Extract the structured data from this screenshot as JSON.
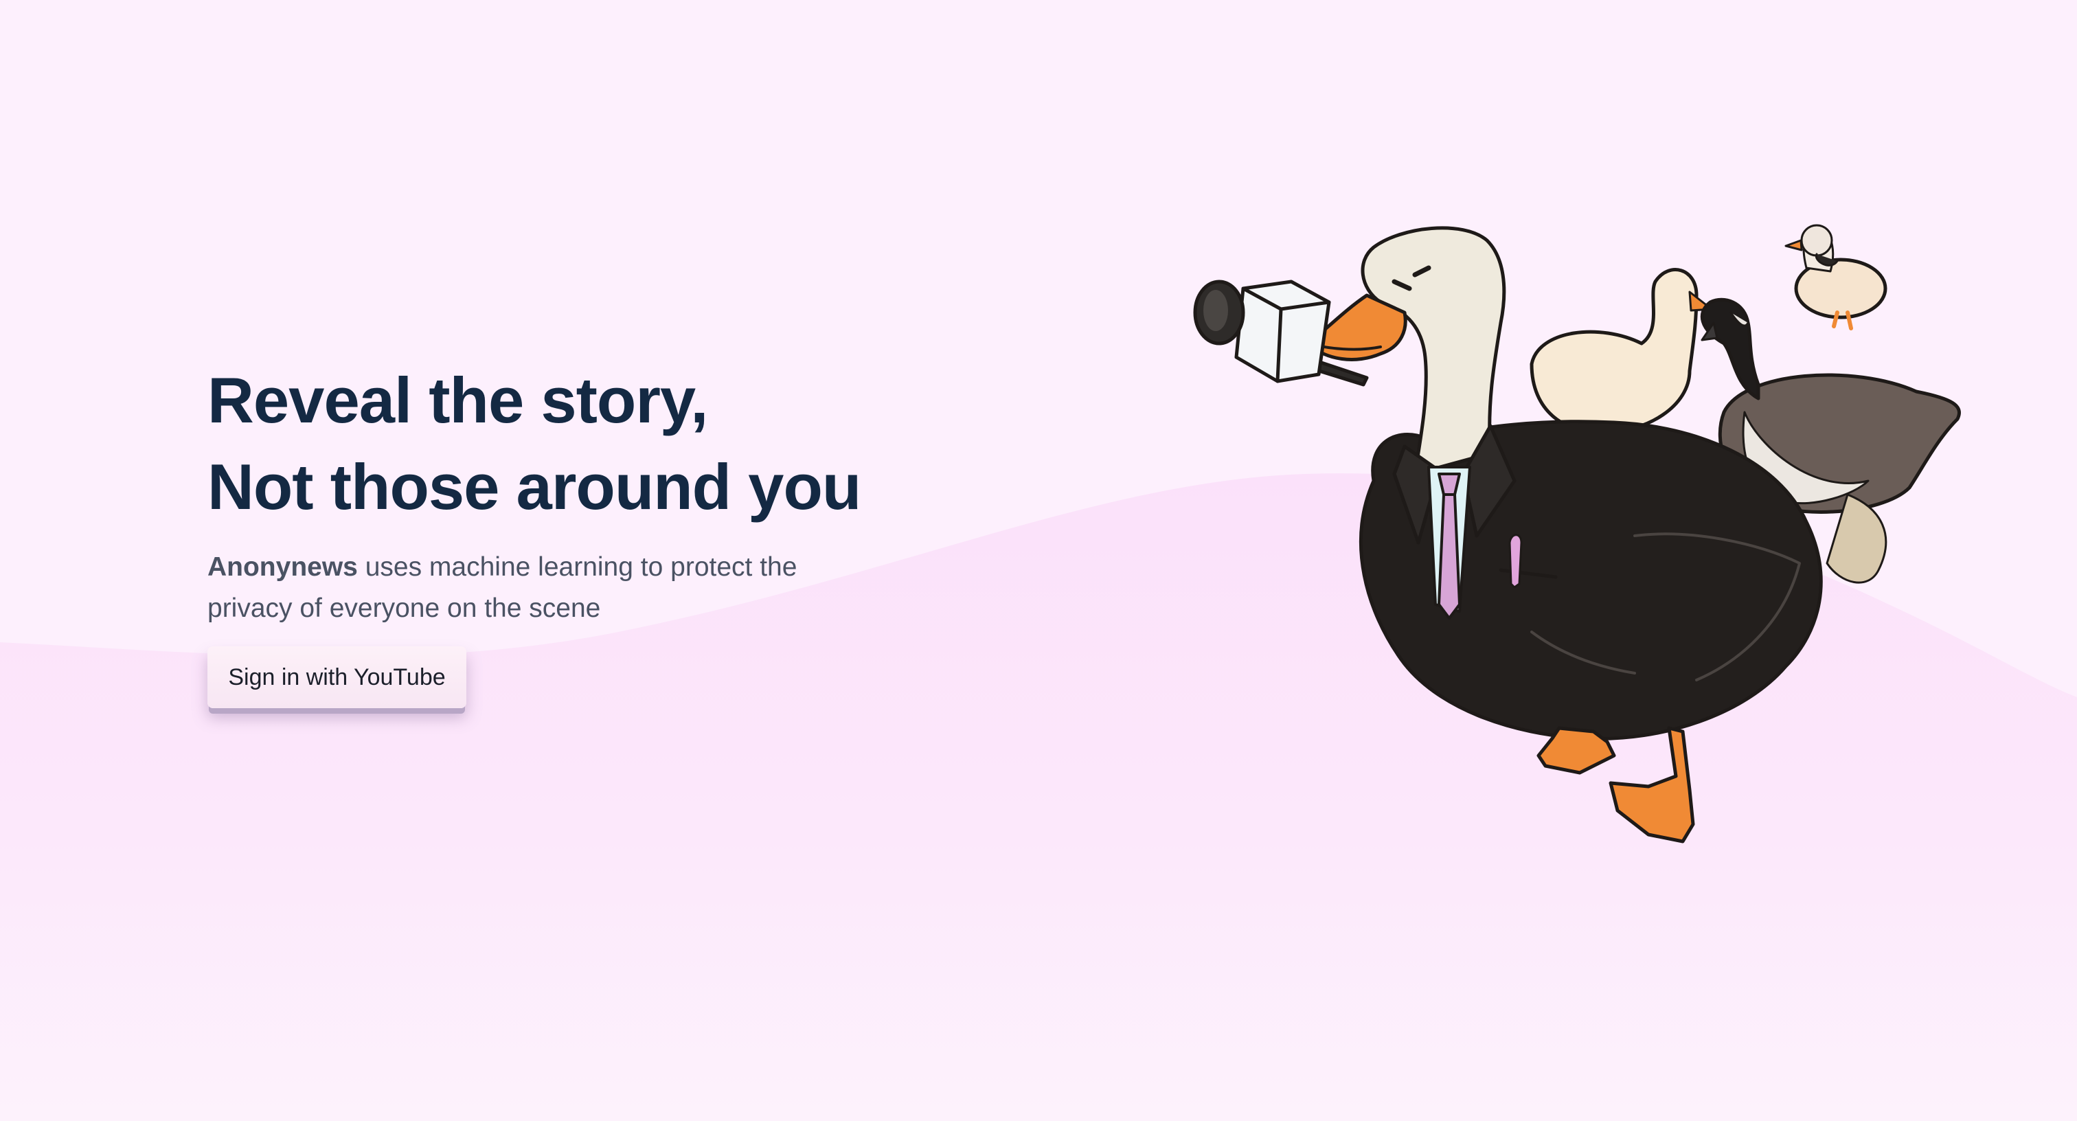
{
  "hero": {
    "headline_line1": "Reveal the story,",
    "headline_line2": "Not those around you",
    "brand": "Anonynews",
    "subtitle_rest": " uses machine learning to protect the privacy of everyone on the scene",
    "cta_label": "Sign in with YouTube"
  },
  "illustration": {
    "icon": "reporter-goose-illustration"
  },
  "colors": {
    "background": "#fdf0fd",
    "wave": "#fbe2fa",
    "headline": "#142943",
    "body_text": "#4a5263",
    "button_bg": "#fdf1f8",
    "goose_orange": "#f08a35",
    "suit": "#231f1d"
  }
}
